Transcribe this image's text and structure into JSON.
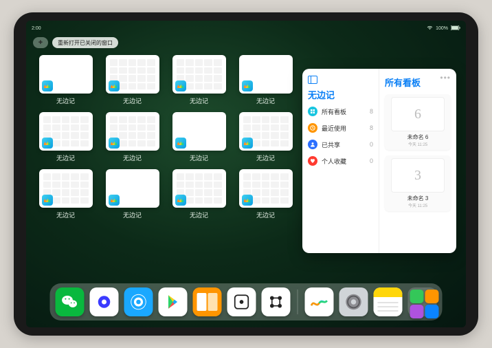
{
  "status": {
    "time": "2:00",
    "right": "100%"
  },
  "toolbar": {
    "add": "+",
    "reopen": "重新打开已关闭的窗口"
  },
  "switcher": {
    "app_label": "无边记",
    "windows": [
      {
        "variant": "blank"
      },
      {
        "variant": "grid"
      },
      {
        "variant": "grid"
      },
      {
        "variant": "blank"
      },
      {
        "variant": "grid"
      },
      {
        "variant": "grid"
      },
      {
        "variant": "blank"
      },
      {
        "variant": "grid"
      },
      {
        "variant": "grid"
      },
      {
        "variant": "blank"
      },
      {
        "variant": "grid"
      },
      {
        "variant": "grid"
      }
    ]
  },
  "app_window": {
    "title": "无边记",
    "menu": [
      {
        "label": "所有看板",
        "count": "8",
        "color": "cyan",
        "icon": "grid"
      },
      {
        "label": "最近使用",
        "count": "8",
        "color": "orange",
        "icon": "clock"
      },
      {
        "label": "已共享",
        "count": "0",
        "color": "blue",
        "icon": "person"
      },
      {
        "label": "个人收藏",
        "count": "0",
        "color": "red",
        "icon": "heart"
      }
    ],
    "right_title": "所有看板",
    "boards": [
      {
        "glyph": "6",
        "name": "未命名 6",
        "time": "今天 11:25"
      },
      {
        "glyph": "3",
        "name": "未命名 3",
        "time": "今天 11:25"
      }
    ]
  },
  "dock": {
    "apps": [
      {
        "name": "wechat",
        "bg": "#09b83e"
      },
      {
        "name": "quark",
        "bg": "#ffffff"
      },
      {
        "name": "qqbrowser",
        "bg": "#1aa8ff"
      },
      {
        "name": "play",
        "bg": "#ffffff"
      },
      {
        "name": "books",
        "bg": "#ff9500"
      },
      {
        "name": "dice",
        "bg": "#ffffff"
      },
      {
        "name": "grid-app",
        "bg": "#ffffff"
      }
    ],
    "recent": [
      {
        "name": "freeform",
        "bg": "#ffffff"
      },
      {
        "name": "settings",
        "bg": "#d0d4d8"
      },
      {
        "name": "notes",
        "bg": "#ffffff"
      }
    ],
    "cluster": [
      {
        "bg": "#34c759"
      },
      {
        "bg": "#ff9500"
      },
      {
        "bg": "#af52de"
      },
      {
        "bg": "#0a84ff"
      }
    ]
  }
}
